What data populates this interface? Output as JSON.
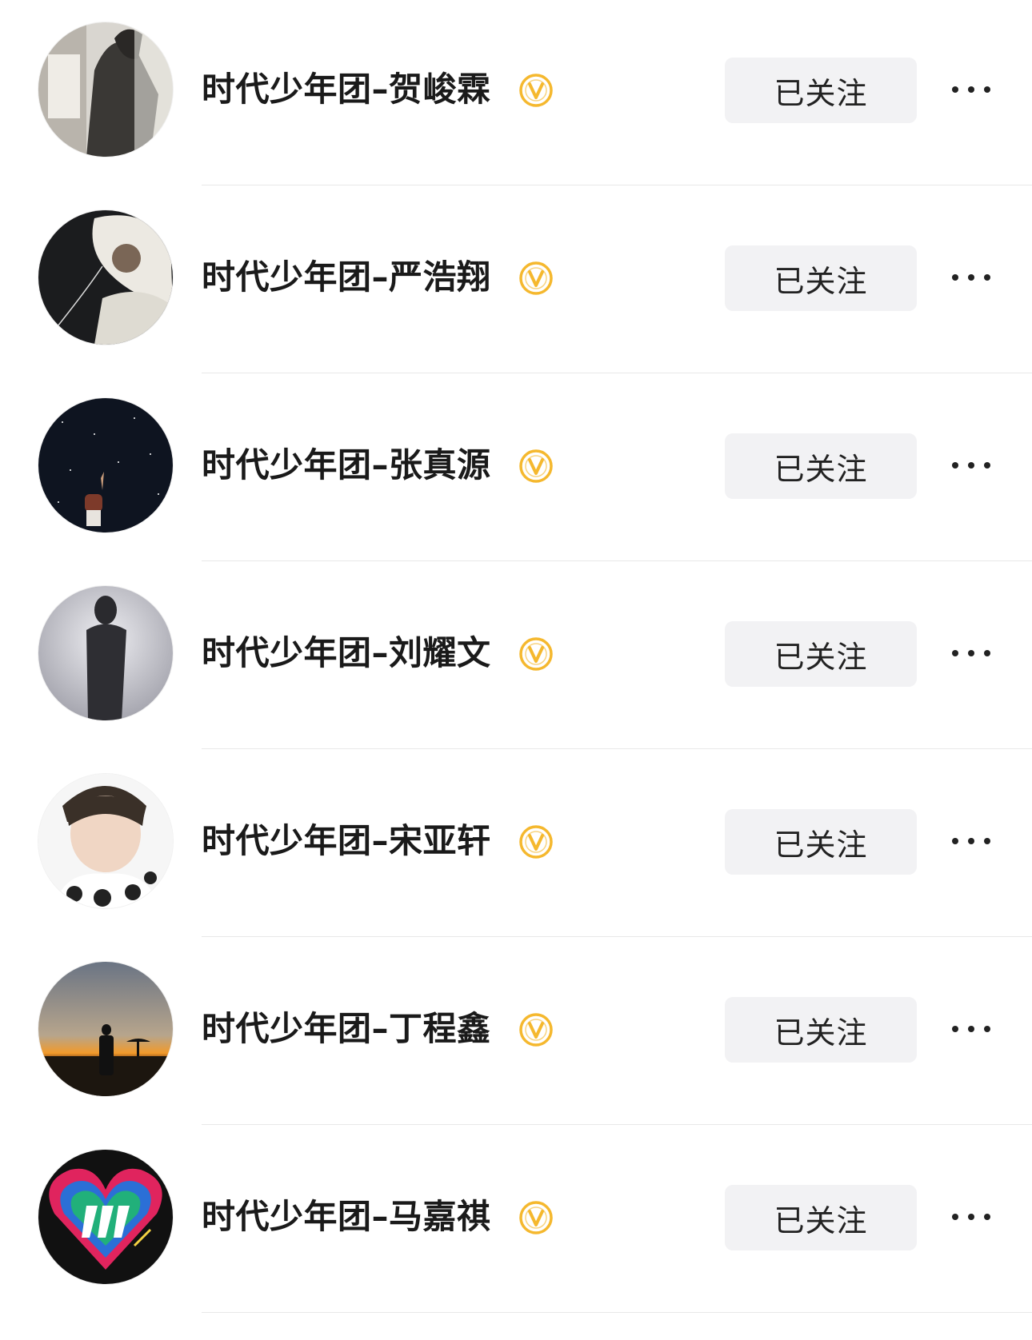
{
  "following_list": [
    {
      "name": "时代少年团–贺峻霖",
      "button_label": "已关注",
      "verified_icon": "verified-v-badge-icon",
      "more_icon": "more-dots-icon"
    },
    {
      "name": "时代少年团–严浩翔",
      "button_label": "已关注",
      "verified_icon": "verified-v-badge-icon",
      "more_icon": "more-dots-icon"
    },
    {
      "name": "时代少年团–张真源",
      "button_label": "已关注",
      "verified_icon": "verified-v-badge-icon",
      "more_icon": "more-dots-icon"
    },
    {
      "name": "时代少年团–刘耀文",
      "button_label": "已关注",
      "verified_icon": "verified-v-badge-icon",
      "more_icon": "more-dots-icon"
    },
    {
      "name": "时代少年团–宋亚轩",
      "button_label": "已关注",
      "verified_icon": "verified-v-badge-icon",
      "more_icon": "more-dots-icon"
    },
    {
      "name": "时代少年团–丁程鑫",
      "button_label": "已关注",
      "verified_icon": "verified-v-badge-icon",
      "more_icon": "more-dots-icon"
    },
    {
      "name": "时代少年团–马嘉祺",
      "button_label": "已关注",
      "verified_icon": "verified-v-badge-icon",
      "more_icon": "more-dots-icon"
    }
  ],
  "colors": {
    "verified_badge": "#F5B82E",
    "button_bg": "#F2F2F4",
    "text": "#1A1A1A",
    "divider": "#E8E8E8"
  }
}
